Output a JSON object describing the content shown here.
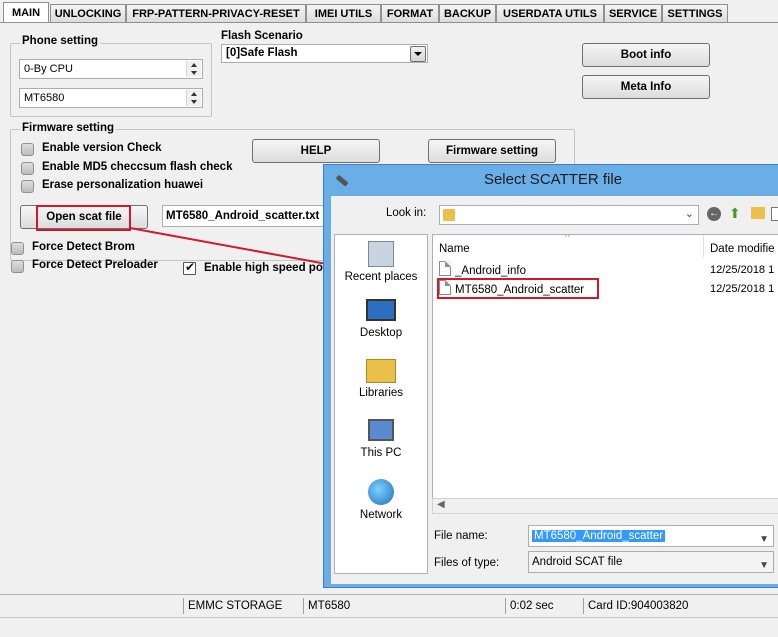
{
  "tabs": [
    "MAIN",
    "UNLOCKING",
    "FRP-PATTERN-PRIVACY-RESET",
    "IMEI UTILS",
    "FORMAT",
    "BACKUP",
    "USERDATA UTILS",
    "SERVICE",
    "SETTINGS"
  ],
  "phone_setting": {
    "label": "Phone setting",
    "cpu_value": "0-By CPU",
    "model_value": "MT6580"
  },
  "flash_scenario": {
    "label": "Flash Scenario",
    "value": "[0]Safe Flash"
  },
  "buttons": {
    "boot_info": "Boot info",
    "meta_info": "Meta Info",
    "help": "HELP",
    "firmware_setting": "Firmware setting",
    "open_scat_file": "Open scat file"
  },
  "firmware_setting": {
    "label": "Firmware setting",
    "options": [
      "Enable version Check",
      "Enable MD5 checcsum flash check",
      "Erase personalization huawei"
    ],
    "scatter_path": "MT6580_Android_scatter.txt"
  },
  "force_options": [
    "Force Detect Brom",
    "Force Detect Preloader"
  ],
  "high_speed": {
    "label": "Enable high speed port",
    "checked": true
  },
  "status_bar": {
    "storage": "EMMC STORAGE",
    "chip": "MT6580",
    "time": "0:02 sec",
    "card_id": "Card ID:904003820"
  },
  "dialog": {
    "title": "Select SCATTER file",
    "look_in_label": "Look in:",
    "places": [
      "Recent places",
      "Desktop",
      "Libraries",
      "This PC",
      "Network"
    ],
    "columns": {
      "name": "Name",
      "date": "Date modifie"
    },
    "files": [
      {
        "name": "_Android_info",
        "date": "12/25/2018 1"
      },
      {
        "name": "MT6580_Android_scatter",
        "date": "12/25/2018 1"
      }
    ],
    "file_name_label": "File name:",
    "file_name_value": "MT6580_Android_scatter",
    "file_type_label": "Files of type:",
    "file_type_value": "Android SCAT file"
  },
  "colors": {
    "dialog_frame": "#6aaee8",
    "highlight_red": "#d01a2c",
    "selection_blue": "#3399ff"
  }
}
